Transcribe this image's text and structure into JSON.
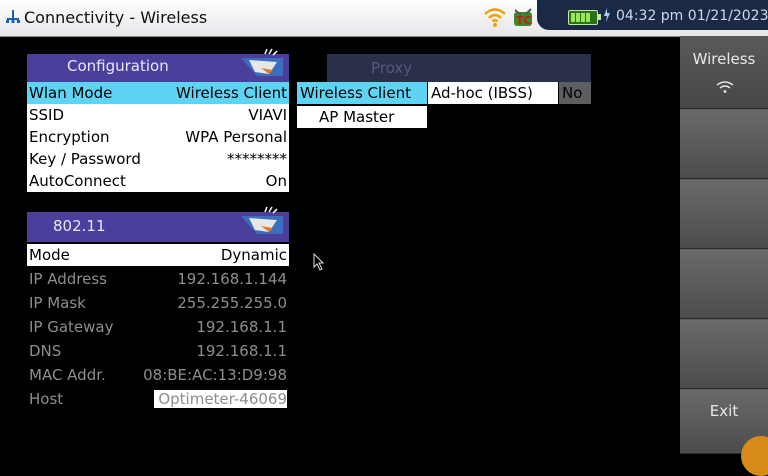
{
  "titlebar": {
    "title": "Connectivity - Wireless",
    "time": "04:32 pm",
    "date": "01/21/2023",
    "icons": [
      "network-tree-icon",
      "wifi-icon",
      "tc-status-icon",
      "battery-icon",
      "plug-icon"
    ]
  },
  "configuration": {
    "header": "Configuration",
    "rows": [
      {
        "label": "Wlan Mode",
        "value": "Wireless Client"
      },
      {
        "label": "SSID",
        "value": "VIAVI"
      },
      {
        "label": "Encryption",
        "value": "WPA Personal"
      },
      {
        "label": "Key / Password",
        "value": "********"
      },
      {
        "label": "AutoConnect",
        "value": "On"
      }
    ]
  },
  "proxy": {
    "header": "Proxy",
    "dropdown_options": [
      "Wireless Client",
      "Ad-hoc (IBSS)",
      "AP Master"
    ],
    "no_label": "No"
  },
  "ieee80211": {
    "header": "802.11",
    "mode": {
      "label": "Mode",
      "value": "Dynamic"
    },
    "rows": [
      {
        "label": "IP Address",
        "value": "192.168.1.144"
      },
      {
        "label": "IP Mask",
        "value": "255.255.255.0"
      },
      {
        "label": "IP Gateway",
        "value": "192.168.1.1"
      },
      {
        "label": "DNS",
        "value": "192.168.1.1"
      },
      {
        "label": "MAC Addr.",
        "value": "08:BE:AC:13:D9:98"
      },
      {
        "label": "Host",
        "value": "Optimeter-46069"
      }
    ]
  },
  "sidebar": {
    "wireless_label": "Wireless",
    "exit_label": "Exit"
  },
  "colors": {
    "panel_header": "#4a3f9a",
    "selected_row": "#5fd4f2",
    "sidebar": "#5c5c5c"
  }
}
